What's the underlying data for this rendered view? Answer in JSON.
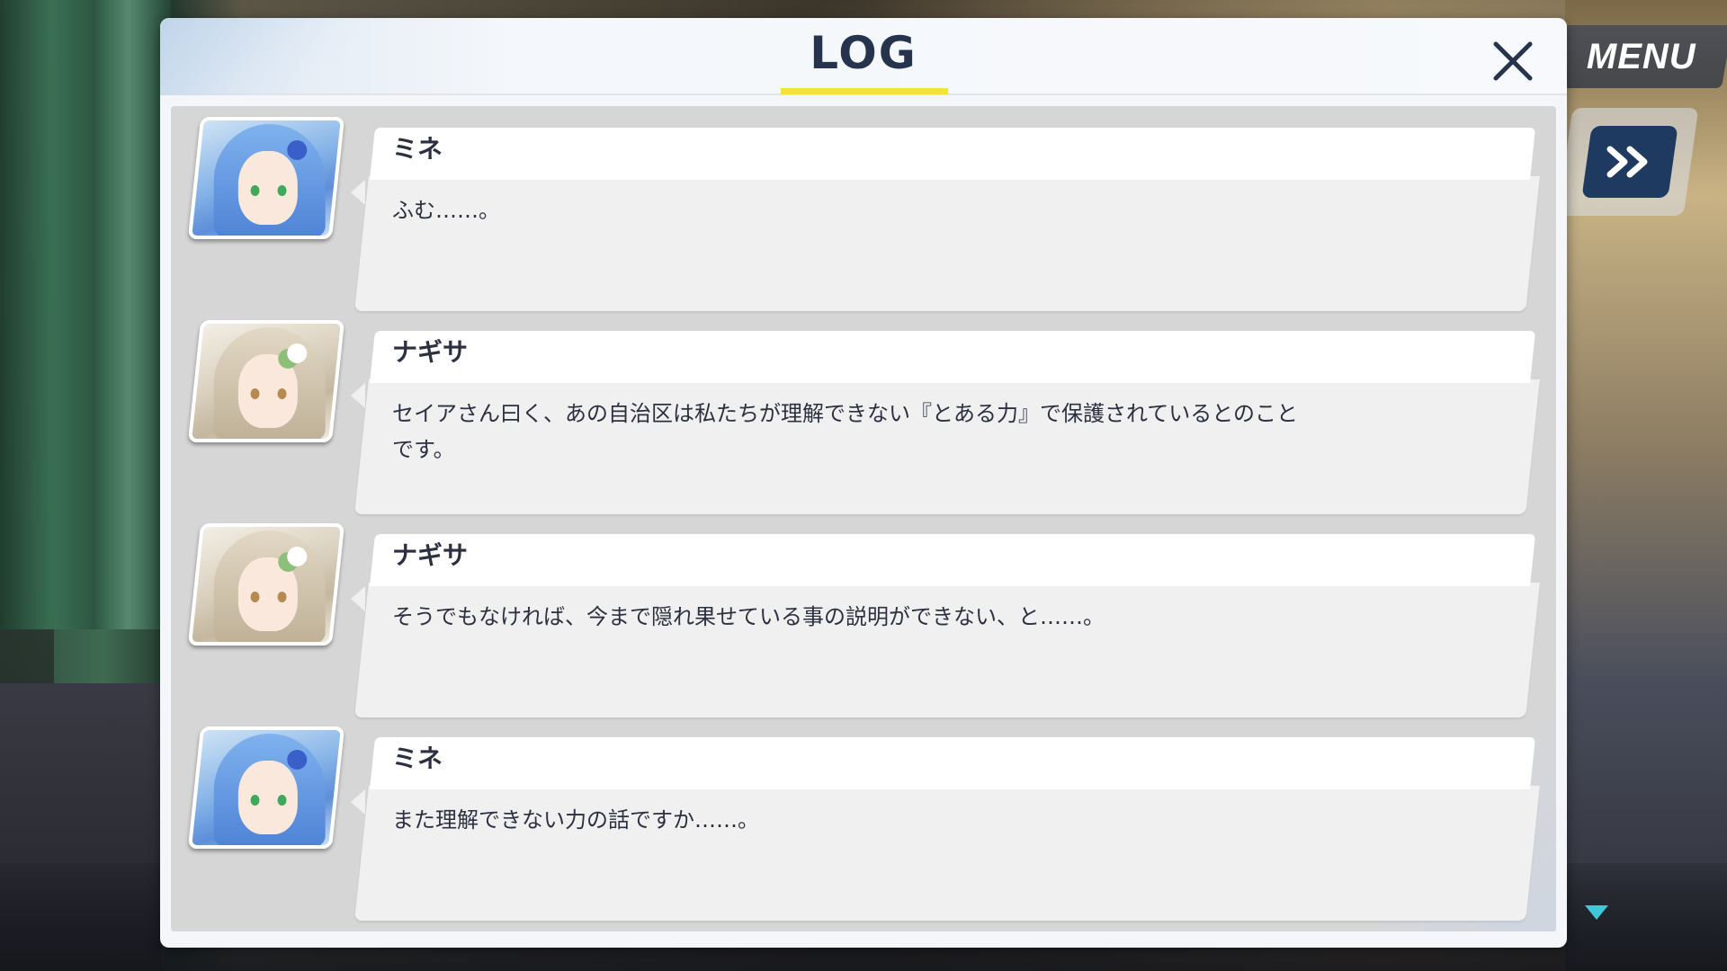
{
  "dialog": {
    "title": "LOG"
  },
  "hud": {
    "menu_label": "MENU"
  },
  "colors": {
    "title_text": "#25334d",
    "title_underline": "#f2e336",
    "name_tab": "#ffffff",
    "message_box": "#f0f0f0",
    "log_body": "#d6d6d6"
  },
  "icons": {
    "close": "close-icon",
    "fast_forward": "fast-forward-icon",
    "scroll_down": "triangle-down-icon"
  },
  "entries": [
    {
      "speaker": "ミネ",
      "text": "ふむ……。",
      "avatar": "mine"
    },
    {
      "speaker": "ナギサ",
      "text": "セイアさん曰く、あの自治区は私たちが理解できない『とある力』で保護されているとのこと\nです。",
      "avatar": "nagisa"
    },
    {
      "speaker": "ナギサ",
      "text": "そうでもなければ、今まで隠れ果せている事の説明ができない、と……。",
      "avatar": "nagisa"
    },
    {
      "speaker": "ミネ",
      "text": "また理解できない力の話ですか……。",
      "avatar": "mine"
    }
  ]
}
